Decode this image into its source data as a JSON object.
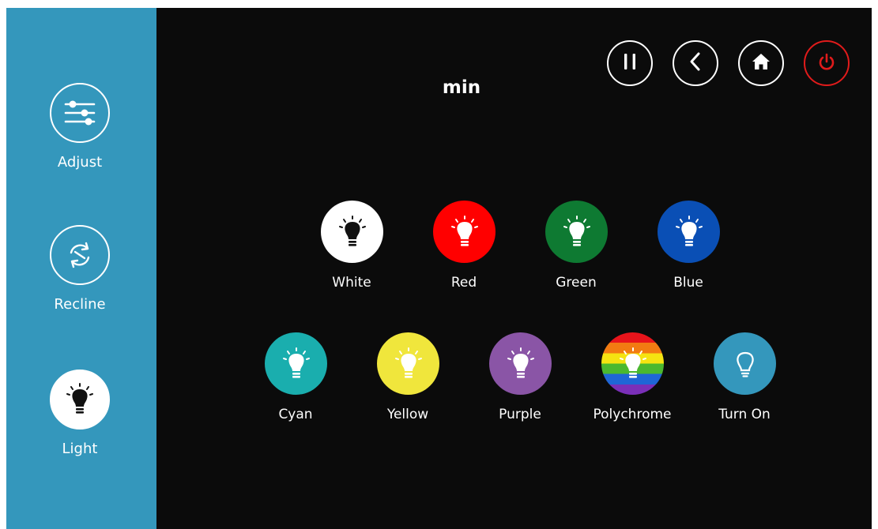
{
  "sidebar": {
    "items": [
      {
        "label": "Adjust",
        "icon": "sliders-icon",
        "active": false
      },
      {
        "label": "Recline",
        "icon": "rotate-arrows-icon",
        "active": false
      },
      {
        "label": "Light",
        "icon": "lightbulb-icon",
        "active": true
      }
    ]
  },
  "header": {
    "title": "min",
    "buttons": [
      {
        "icon": "pause-icon"
      },
      {
        "icon": "back-chevron-icon"
      },
      {
        "icon": "home-icon"
      },
      {
        "icon": "power-icon",
        "color": "#e11b1b"
      }
    ]
  },
  "lights": {
    "row1": [
      {
        "label": "White",
        "color": "#ffffff"
      },
      {
        "label": "Red",
        "color": "#ff0000"
      },
      {
        "label": "Green",
        "color": "#0e7a32"
      },
      {
        "label": "Blue",
        "color": "#0a4fb5"
      }
    ],
    "row2": [
      {
        "label": "Cyan",
        "color": "#1aaeae"
      },
      {
        "label": "Yellow",
        "color": "#f0e63c"
      },
      {
        "label": "Purple",
        "color": "#8a55a6"
      },
      {
        "label": "Polychrome",
        "color": "rainbow"
      },
      {
        "label": "Turn On",
        "color": "#3497bc"
      }
    ]
  },
  "colors": {
    "sidebar_bg": "#3497bc",
    "main_bg": "#0b0b0b",
    "power": "#e11b1b"
  }
}
